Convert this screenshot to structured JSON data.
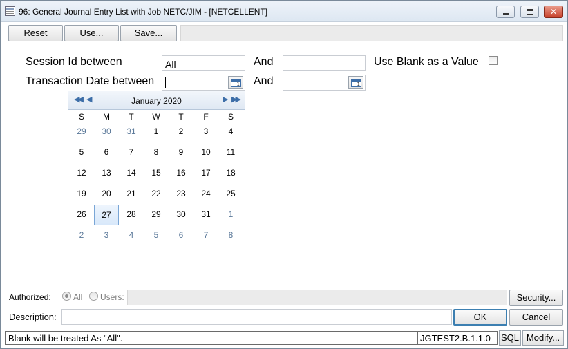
{
  "window": {
    "title": "96:  General Journal Entry List with Job NETC/JIM - [NETCELLENT]"
  },
  "toolbar": {
    "reset_label": "Reset",
    "use_label": "Use...",
    "save_label": "Save..."
  },
  "form": {
    "session_label": "Session Id between",
    "session_from_value": "All",
    "session_to_value": "",
    "and_label": "And",
    "use_blank_label": "Use Blank as a Value",
    "use_blank_checked": false,
    "date_label": "Transaction Date between",
    "date_from_value": "",
    "date_to_value": ""
  },
  "calendar": {
    "month_title": "January 2020",
    "days_of_week": [
      "S",
      "M",
      "T",
      "W",
      "T",
      "F",
      "S"
    ],
    "weeks": [
      [
        {
          "d": "29",
          "other": true
        },
        {
          "d": "30",
          "other": true
        },
        {
          "d": "31",
          "other": true
        },
        {
          "d": "1"
        },
        {
          "d": "2"
        },
        {
          "d": "3"
        },
        {
          "d": "4"
        }
      ],
      [
        {
          "d": "5"
        },
        {
          "d": "6"
        },
        {
          "d": "7"
        },
        {
          "d": "8"
        },
        {
          "d": "9"
        },
        {
          "d": "10"
        },
        {
          "d": "11"
        }
      ],
      [
        {
          "d": "12"
        },
        {
          "d": "13"
        },
        {
          "d": "14"
        },
        {
          "d": "15"
        },
        {
          "d": "16"
        },
        {
          "d": "17"
        },
        {
          "d": "18"
        }
      ],
      [
        {
          "d": "19"
        },
        {
          "d": "20"
        },
        {
          "d": "21"
        },
        {
          "d": "22"
        },
        {
          "d": "23"
        },
        {
          "d": "24"
        },
        {
          "d": "25"
        }
      ],
      [
        {
          "d": "26"
        },
        {
          "d": "27",
          "selected": true
        },
        {
          "d": "28"
        },
        {
          "d": "29"
        },
        {
          "d": "30"
        },
        {
          "d": "31"
        },
        {
          "d": "1",
          "other": true
        }
      ],
      [
        {
          "d": "2",
          "other": true
        },
        {
          "d": "3",
          "other": true
        },
        {
          "d": "4",
          "other": true
        },
        {
          "d": "5",
          "other": true
        },
        {
          "d": "6",
          "other": true
        },
        {
          "d": "7",
          "other": true
        },
        {
          "d": "8",
          "other": true
        }
      ]
    ]
  },
  "authorized": {
    "label": "Authorized:",
    "all_label": "All",
    "users_label": "Users:",
    "selected": "All",
    "security_label": "Security..."
  },
  "description": {
    "label": "Description:",
    "value": ""
  },
  "buttons": {
    "ok_label": "OK",
    "cancel_label": "Cancel"
  },
  "status": {
    "message": "Blank will be treated As \"All\".",
    "version": "JGTEST2.B.1.1.0",
    "sql_label": "SQL",
    "modify_label": "Modify..."
  }
}
